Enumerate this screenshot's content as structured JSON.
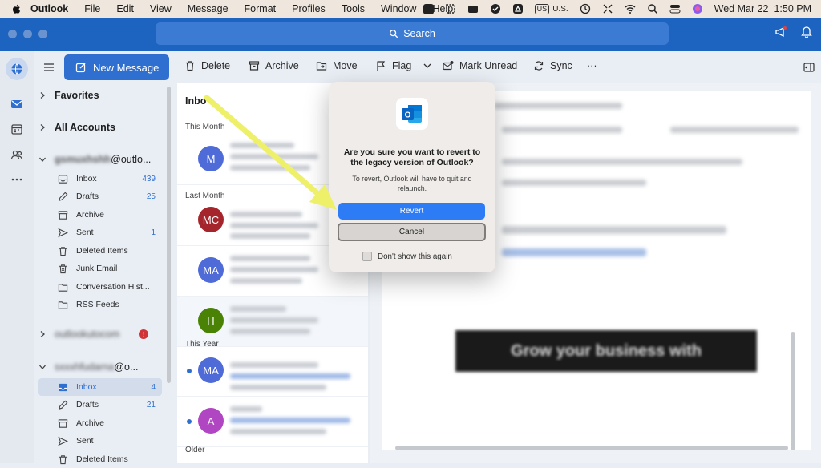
{
  "menubar": {
    "app": "Outlook",
    "items": [
      "File",
      "Edit",
      "View",
      "Message",
      "Format",
      "Profiles",
      "Tools",
      "Window",
      "Help"
    ],
    "input_source": "U.S.",
    "input_badge": "US",
    "datetime": "Wed Mar 22  1:50 PM"
  },
  "titlebar": {
    "search_label": "Search"
  },
  "toolbar": {
    "new_message": "New Message",
    "delete": "Delete",
    "archive": "Archive",
    "move": "Move",
    "flag": "Flag",
    "mark_unread": "Mark Unread",
    "sync": "Sync",
    "more": "···"
  },
  "folders": {
    "favorites": "Favorites",
    "all_accounts": "All Accounts",
    "account1": {
      "name": "@outlo...",
      "items": [
        {
          "label": "Inbox",
          "count": "439"
        },
        {
          "label": "Drafts",
          "count": "25"
        },
        {
          "label": "Archive",
          "count": ""
        },
        {
          "label": "Sent",
          "count": "1"
        },
        {
          "label": "Deleted Items",
          "count": ""
        },
        {
          "label": "Junk Email",
          "count": ""
        },
        {
          "label": "Conversation Hist...",
          "count": ""
        },
        {
          "label": "RSS Feeds",
          "count": ""
        }
      ]
    },
    "account2": {
      "badge": "!"
    },
    "account3": {
      "name": "@o...",
      "items": [
        {
          "label": "Inbox",
          "count": "4"
        },
        {
          "label": "Drafts",
          "count": "21"
        },
        {
          "label": "Archive",
          "count": ""
        },
        {
          "label": "Sent",
          "count": ""
        },
        {
          "label": "Deleted Items",
          "count": ""
        }
      ]
    }
  },
  "msglist": {
    "header": "Inbo",
    "groups": [
      "This Month",
      "Last Month",
      "This Year",
      "Older"
    ],
    "avatars": [
      {
        "initials": "M",
        "color": "#4f6bd8"
      },
      {
        "initials": "MC",
        "color": "#a4262c"
      },
      {
        "initials": "MA",
        "color": "#4f6bd8"
      },
      {
        "initials": "H",
        "color": "#498205"
      },
      {
        "initials": "MA",
        "color": "#4f6bd8"
      },
      {
        "initials": "A",
        "color": "#b146c2"
      }
    ]
  },
  "dialog": {
    "title": "Are you sure you want to revert to the legacy version of Outlook?",
    "message": "To revert, Outlook will have to quit and relaunch.",
    "revert": "Revert",
    "cancel": "Cancel",
    "checkbox": "Don't show this again"
  },
  "colors": {
    "accent": "#2f6fd0",
    "titlebar": "#1d63c0",
    "arrow": "#eef06a"
  }
}
